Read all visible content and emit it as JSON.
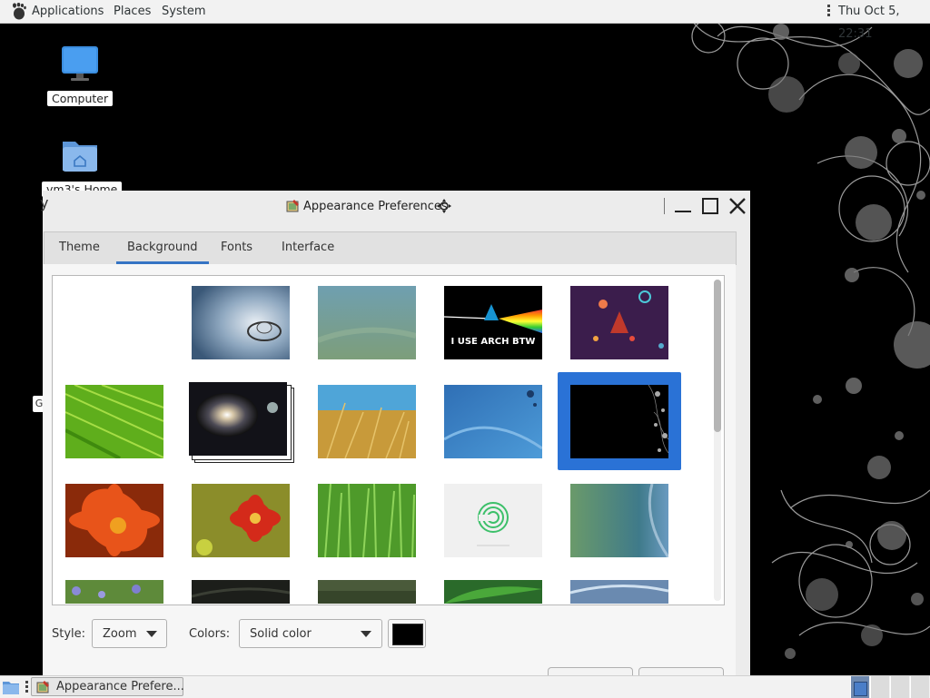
{
  "top_panel": {
    "menus": [
      "Applications",
      "Places",
      "System"
    ],
    "clock": "Thu Oct  5, 22:31"
  },
  "desktop": {
    "icons": [
      {
        "label": "Computer",
        "icon": "monitor-icon"
      },
      {
        "label": "vm3's Home",
        "icon": "home-folder-icon"
      }
    ],
    "stray_char": "G",
    "stray_left": "y"
  },
  "window": {
    "title": "Appearance Preferences",
    "tabs": [
      "Theme",
      "Background",
      "Fonts",
      "Interface"
    ],
    "active_tab": "Background",
    "wallpapers": [
      "no-wallpaper",
      "water-drop",
      "blurred-blue-green",
      "arch-prism",
      "arch-purple-bubbles",
      "green-leaf",
      "spiral-galaxy",
      "wheat-field",
      "blue-drops",
      "black-bubbles",
      "orange-flower",
      "red-flower",
      "green-grass",
      "green-logo",
      "teal-gradient",
      "purple-flowers",
      "dark-texture",
      "green-dark",
      "green-leaf-drops",
      "blue-waves"
    ],
    "selected_wallpaper": "black-bubbles",
    "arch_text": "I USE ARCH BTW",
    "style_label": "Style:",
    "style_value": "Zoom",
    "colors_label": "Colors:",
    "colors_value": "Solid color",
    "color_swatch": "#000000",
    "accent": "#2a72d6"
  },
  "taskbar": {
    "task_label": "Appearance Prefere...",
    "workspaces": 4,
    "active_workspace": 1
  }
}
